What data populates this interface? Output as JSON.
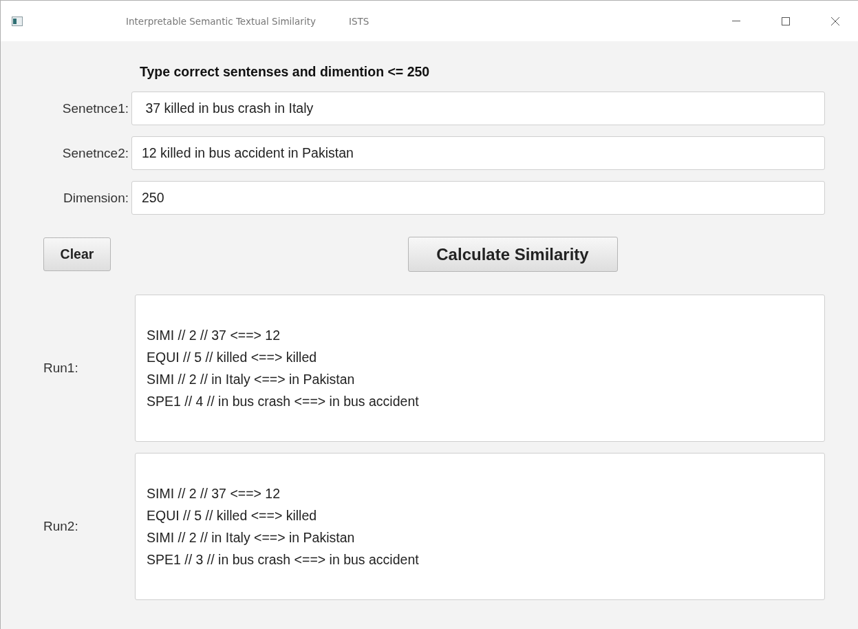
{
  "window": {
    "title": "Interpretable Semantic Textual Similarity",
    "subtitle": "ISTS"
  },
  "heading": "Type correct sentenses and dimention <= 250",
  "fields": [
    {
      "label": "Senetnce1:",
      "value": " 37 killed in bus crash in Italy"
    },
    {
      "label": "Senetnce2:",
      "value": "12 killed in bus accident in Pakistan"
    },
    {
      "label": "Dimension:",
      "value": "250"
    }
  ],
  "buttons": {
    "clear": "Clear",
    "calculate": "Calculate Similarity"
  },
  "runs": [
    {
      "label": "Run1:",
      "lines": [
        "SIMI // 2 // 37 <==> 12",
        "EQUI // 5 // killed <==> killed",
        "SIMI // 2 // in Italy <==> in Pakistan",
        "SPE1 // 4 // in bus crash <==> in bus accident"
      ]
    },
    {
      "label": "Run2:",
      "lines": [
        "SIMI // 2 // 37 <==> 12",
        "EQUI // 5 // killed <==> killed",
        "SIMI // 2 // in Italy <==> in Pakistan",
        "SPE1 // 3 // in bus crash <==> in bus accident"
      ]
    }
  ]
}
